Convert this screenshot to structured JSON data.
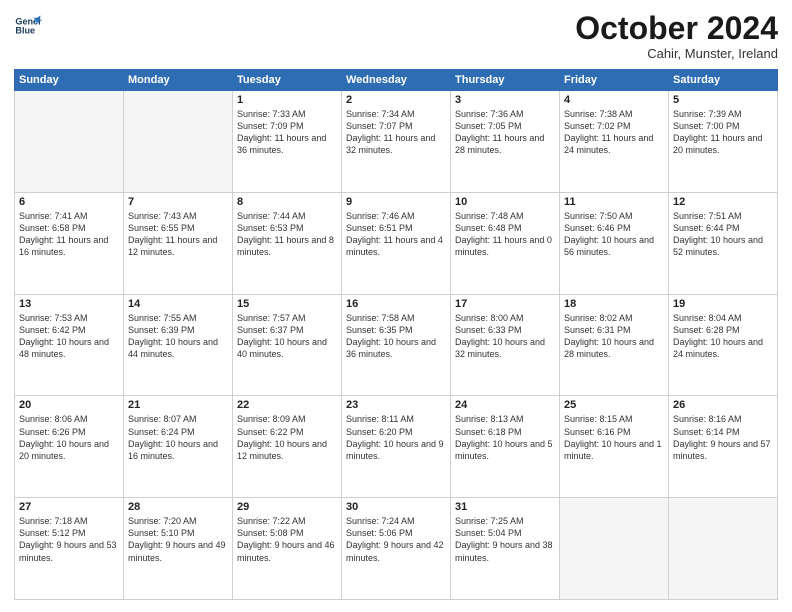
{
  "header": {
    "logo_line1": "General",
    "logo_line2": "Blue",
    "month_title": "October 2024",
    "location": "Cahir, Munster, Ireland"
  },
  "days_of_week": [
    "Sunday",
    "Monday",
    "Tuesday",
    "Wednesday",
    "Thursday",
    "Friday",
    "Saturday"
  ],
  "weeks": [
    [
      {
        "day": "",
        "text": ""
      },
      {
        "day": "",
        "text": ""
      },
      {
        "day": "1",
        "text": "Sunrise: 7:33 AM\nSunset: 7:09 PM\nDaylight: 11 hours\nand 36 minutes."
      },
      {
        "day": "2",
        "text": "Sunrise: 7:34 AM\nSunset: 7:07 PM\nDaylight: 11 hours\nand 32 minutes."
      },
      {
        "day": "3",
        "text": "Sunrise: 7:36 AM\nSunset: 7:05 PM\nDaylight: 11 hours\nand 28 minutes."
      },
      {
        "day": "4",
        "text": "Sunrise: 7:38 AM\nSunset: 7:02 PM\nDaylight: 11 hours\nand 24 minutes."
      },
      {
        "day": "5",
        "text": "Sunrise: 7:39 AM\nSunset: 7:00 PM\nDaylight: 11 hours\nand 20 minutes."
      }
    ],
    [
      {
        "day": "6",
        "text": "Sunrise: 7:41 AM\nSunset: 6:58 PM\nDaylight: 11 hours\nand 16 minutes."
      },
      {
        "day": "7",
        "text": "Sunrise: 7:43 AM\nSunset: 6:55 PM\nDaylight: 11 hours\nand 12 minutes."
      },
      {
        "day": "8",
        "text": "Sunrise: 7:44 AM\nSunset: 6:53 PM\nDaylight: 11 hours\nand 8 minutes."
      },
      {
        "day": "9",
        "text": "Sunrise: 7:46 AM\nSunset: 6:51 PM\nDaylight: 11 hours\nand 4 minutes."
      },
      {
        "day": "10",
        "text": "Sunrise: 7:48 AM\nSunset: 6:48 PM\nDaylight: 11 hours\nand 0 minutes."
      },
      {
        "day": "11",
        "text": "Sunrise: 7:50 AM\nSunset: 6:46 PM\nDaylight: 10 hours\nand 56 minutes."
      },
      {
        "day": "12",
        "text": "Sunrise: 7:51 AM\nSunset: 6:44 PM\nDaylight: 10 hours\nand 52 minutes."
      }
    ],
    [
      {
        "day": "13",
        "text": "Sunrise: 7:53 AM\nSunset: 6:42 PM\nDaylight: 10 hours\nand 48 minutes."
      },
      {
        "day": "14",
        "text": "Sunrise: 7:55 AM\nSunset: 6:39 PM\nDaylight: 10 hours\nand 44 minutes."
      },
      {
        "day": "15",
        "text": "Sunrise: 7:57 AM\nSunset: 6:37 PM\nDaylight: 10 hours\nand 40 minutes."
      },
      {
        "day": "16",
        "text": "Sunrise: 7:58 AM\nSunset: 6:35 PM\nDaylight: 10 hours\nand 36 minutes."
      },
      {
        "day": "17",
        "text": "Sunrise: 8:00 AM\nSunset: 6:33 PM\nDaylight: 10 hours\nand 32 minutes."
      },
      {
        "day": "18",
        "text": "Sunrise: 8:02 AM\nSunset: 6:31 PM\nDaylight: 10 hours\nand 28 minutes."
      },
      {
        "day": "19",
        "text": "Sunrise: 8:04 AM\nSunset: 6:28 PM\nDaylight: 10 hours\nand 24 minutes."
      }
    ],
    [
      {
        "day": "20",
        "text": "Sunrise: 8:06 AM\nSunset: 6:26 PM\nDaylight: 10 hours\nand 20 minutes."
      },
      {
        "day": "21",
        "text": "Sunrise: 8:07 AM\nSunset: 6:24 PM\nDaylight: 10 hours\nand 16 minutes."
      },
      {
        "day": "22",
        "text": "Sunrise: 8:09 AM\nSunset: 6:22 PM\nDaylight: 10 hours\nand 12 minutes."
      },
      {
        "day": "23",
        "text": "Sunrise: 8:11 AM\nSunset: 6:20 PM\nDaylight: 10 hours\nand 9 minutes."
      },
      {
        "day": "24",
        "text": "Sunrise: 8:13 AM\nSunset: 6:18 PM\nDaylight: 10 hours\nand 5 minutes."
      },
      {
        "day": "25",
        "text": "Sunrise: 8:15 AM\nSunset: 6:16 PM\nDaylight: 10 hours\nand 1 minute."
      },
      {
        "day": "26",
        "text": "Sunrise: 8:16 AM\nSunset: 6:14 PM\nDaylight: 9 hours\nand 57 minutes."
      }
    ],
    [
      {
        "day": "27",
        "text": "Sunrise: 7:18 AM\nSunset: 5:12 PM\nDaylight: 9 hours\nand 53 minutes."
      },
      {
        "day": "28",
        "text": "Sunrise: 7:20 AM\nSunset: 5:10 PM\nDaylight: 9 hours\nand 49 minutes."
      },
      {
        "day": "29",
        "text": "Sunrise: 7:22 AM\nSunset: 5:08 PM\nDaylight: 9 hours\nand 46 minutes."
      },
      {
        "day": "30",
        "text": "Sunrise: 7:24 AM\nSunset: 5:06 PM\nDaylight: 9 hours\nand 42 minutes."
      },
      {
        "day": "31",
        "text": "Sunrise: 7:25 AM\nSunset: 5:04 PM\nDaylight: 9 hours\nand 38 minutes."
      },
      {
        "day": "",
        "text": ""
      },
      {
        "day": "",
        "text": ""
      }
    ]
  ]
}
